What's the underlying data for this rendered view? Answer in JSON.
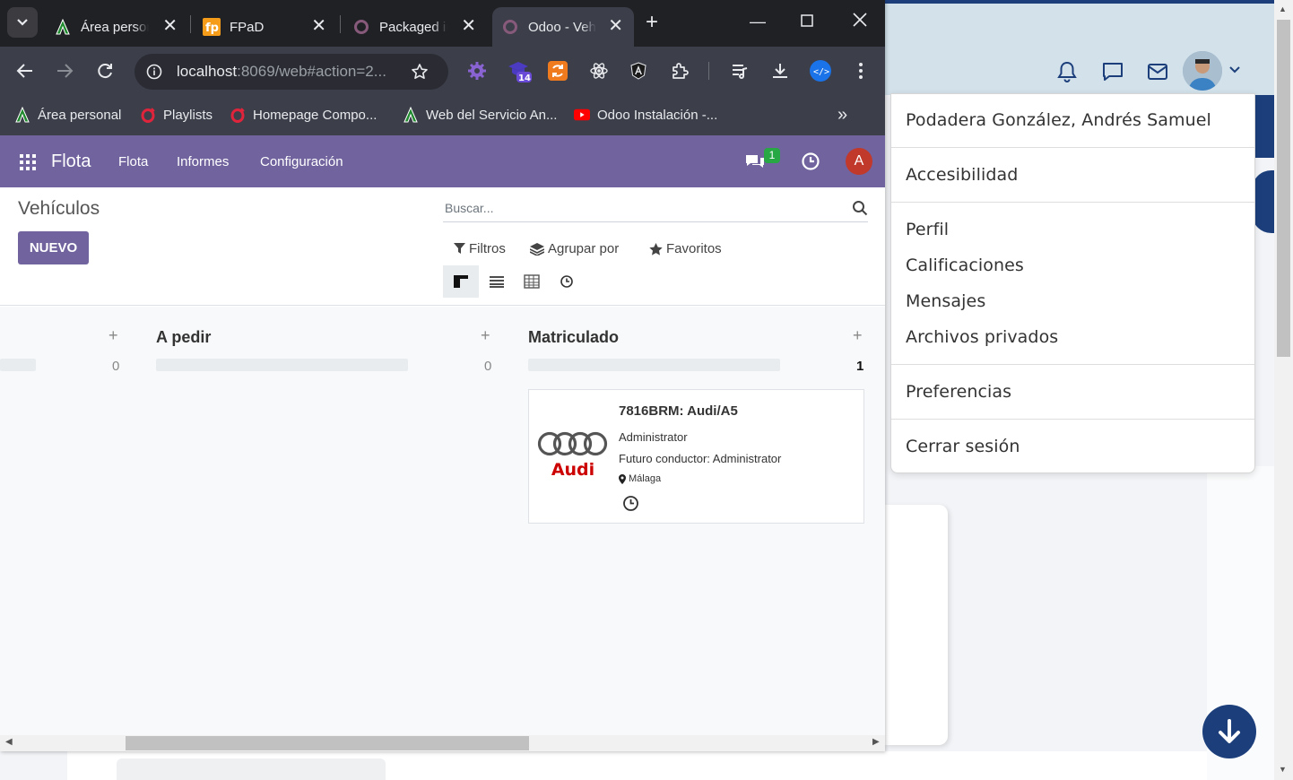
{
  "browser": {
    "tabs": [
      {
        "title": "Área personal",
        "favicon": "moodle-a-icon",
        "color": "#1f8a2e"
      },
      {
        "title": "FPaD",
        "favicon": "fpad-icon",
        "color": "#f59c1a"
      },
      {
        "title": "Packaged ir",
        "favicon": "odoo-circle-icon",
        "color": "#875a7b"
      },
      {
        "title": "Odoo - Veh",
        "favicon": "odoo-circle-icon",
        "color": "#875a7b"
      }
    ],
    "url_host": "localhost",
    "url_rest": ":8069/web#action=2...",
    "extension_badge": "14",
    "bookmarks": [
      {
        "label": "Área personal",
        "icon": "moodle-a-icon"
      },
      {
        "label": "Playlists",
        "icon": "opera-icon"
      },
      {
        "label": "Homepage Compo...",
        "icon": "opera-icon"
      },
      {
        "label": "Web del Servicio An...",
        "icon": "moodle-a-icon"
      },
      {
        "label": "Odoo Instalación -...",
        "icon": "youtube-icon"
      }
    ],
    "more_bookmarks": "»"
  },
  "odoo": {
    "app_name": "Flota",
    "nav": [
      "Flota",
      "Informes",
      "Configuración"
    ],
    "chat_count": "1",
    "avatar_letter": "A",
    "breadcrumb": "Vehículos",
    "new_button": "NUEVO",
    "search_placeholder": "Buscar...",
    "filters": "Filtros",
    "group_by": "Agrupar por",
    "favorites": "Favoritos",
    "columns": [
      {
        "title": "",
        "count": "0"
      },
      {
        "title": "A pedir",
        "count": "0"
      },
      {
        "title": "Matriculado",
        "count": "1"
      }
    ],
    "vehicle_card": {
      "title": "7816BRM: Audi/A5",
      "driver": "Administrator",
      "future_driver": "Futuro conductor: Administrator",
      "location": "Málaga",
      "brand_logo_text": "Audi"
    }
  },
  "user_menu": {
    "user_name": "Podadera González, Andrés Samuel",
    "items": [
      "Accesibilidad",
      "Perfil",
      "Calificaciones",
      "Mensajes",
      "Archivos privados",
      "Preferencias",
      "Cerrar sesión"
    ]
  },
  "colors": {
    "odoo_purple": "#71639e",
    "navy": "#1c3f7c",
    "chrome_dark": "#202124",
    "chrome_toolbar": "#3c3e4a"
  }
}
